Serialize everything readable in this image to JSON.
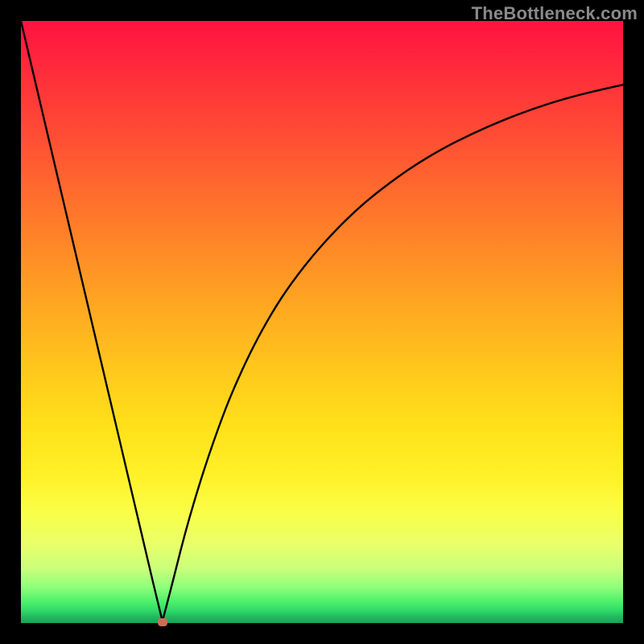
{
  "watermark": "TheBottleneck.com",
  "colors": {
    "frame": "#000000",
    "curve": "#000000",
    "marker": "#d36a58"
  },
  "chart_data": {
    "type": "line",
    "title": "",
    "xlabel": "",
    "ylabel": "",
    "xlim": [
      0,
      100
    ],
    "ylim": [
      0,
      100
    ],
    "grid": false,
    "x": [
      0,
      2,
      4,
      6,
      8,
      10,
      12,
      14,
      16,
      18,
      20,
      22,
      23.5,
      25,
      27,
      29,
      31,
      33,
      35,
      38,
      41,
      44,
      48,
      52,
      56,
      60,
      65,
      70,
      75,
      80,
      85,
      90,
      95,
      100
    ],
    "values": [
      100,
      91.5,
      83,
      74.5,
      66,
      57.5,
      49,
      40.5,
      32,
      23.5,
      15,
      6.5,
      0.3,
      6,
      14,
      21,
      27.3,
      33,
      38.2,
      44.8,
      50.4,
      55.2,
      60.5,
      65,
      68.9,
      72.2,
      75.8,
      78.8,
      81.3,
      83.5,
      85.4,
      87,
      88.3,
      89.4
    ],
    "marker": {
      "x": 23.5,
      "y": 0.2
    },
    "notes": "V-shaped bottleneck curve on rainbow heat background; minimum at ~23.5% on x-axis."
  }
}
